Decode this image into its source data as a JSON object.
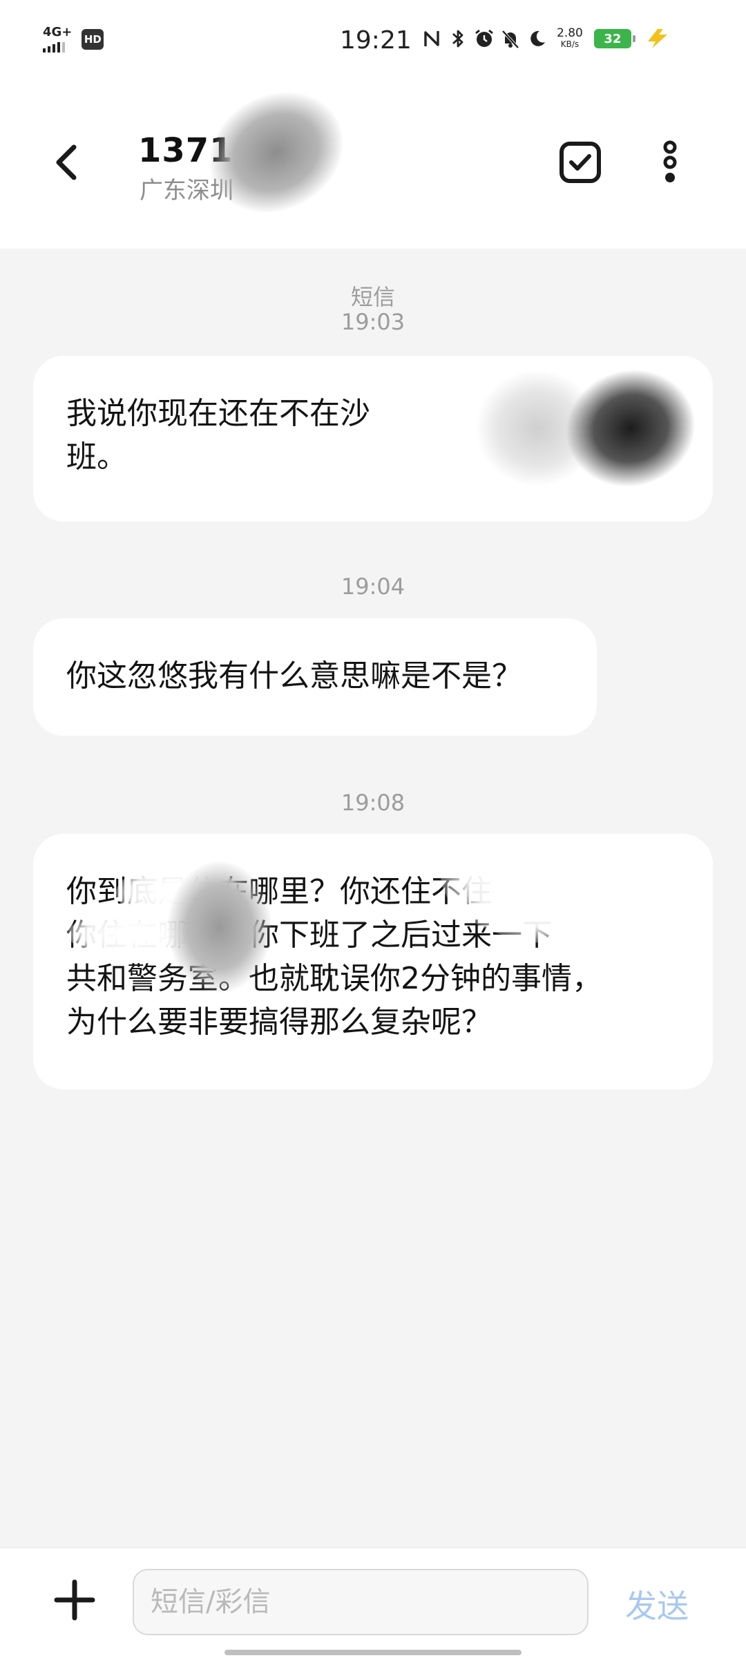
{
  "status_bar": {
    "network": "4G+",
    "hd_label": "HD",
    "time": "19:21",
    "speed_value": "2.80",
    "speed_unit": "KB/s",
    "battery": "32",
    "icons": [
      "nfc-icon",
      "bluetooth-icon",
      "alarm-icon",
      "mute-bell-icon",
      "moon-icon",
      "charging-bolt-icon"
    ]
  },
  "header": {
    "contact_name": "1371",
    "contact_location": "广东深圳",
    "icons": {
      "back": "chevron-left-icon",
      "select": "checkbox-icon",
      "more": "more-vertical-icon"
    }
  },
  "conversation": {
    "type_label": "短信",
    "messages": [
      {
        "time": "19:03",
        "text": "我说你现在还在不在沙\n班。"
      },
      {
        "time": "19:04",
        "text": "你这忽悠我有什么意思嘛是不是？"
      },
      {
        "time": "19:08",
        "text": "你到底是住在哪里？你还住不住\n你住在哪里，你下班了之后过来一下\n共和警务室。也就耽误你2分钟的事情，\n为什么要非要搞得那么复杂呢？"
      }
    ]
  },
  "input_bar": {
    "placeholder": "短信/彩信",
    "send_label": "发送",
    "add_icon": "plus-icon"
  },
  "colors": {
    "background": "#f4f4f4",
    "bubble": "#ffffff",
    "battery": "#3bb54a",
    "charging": "#f2c21b",
    "send_disabled": "#a8c8f0",
    "meta_text": "#9c9c9c"
  }
}
